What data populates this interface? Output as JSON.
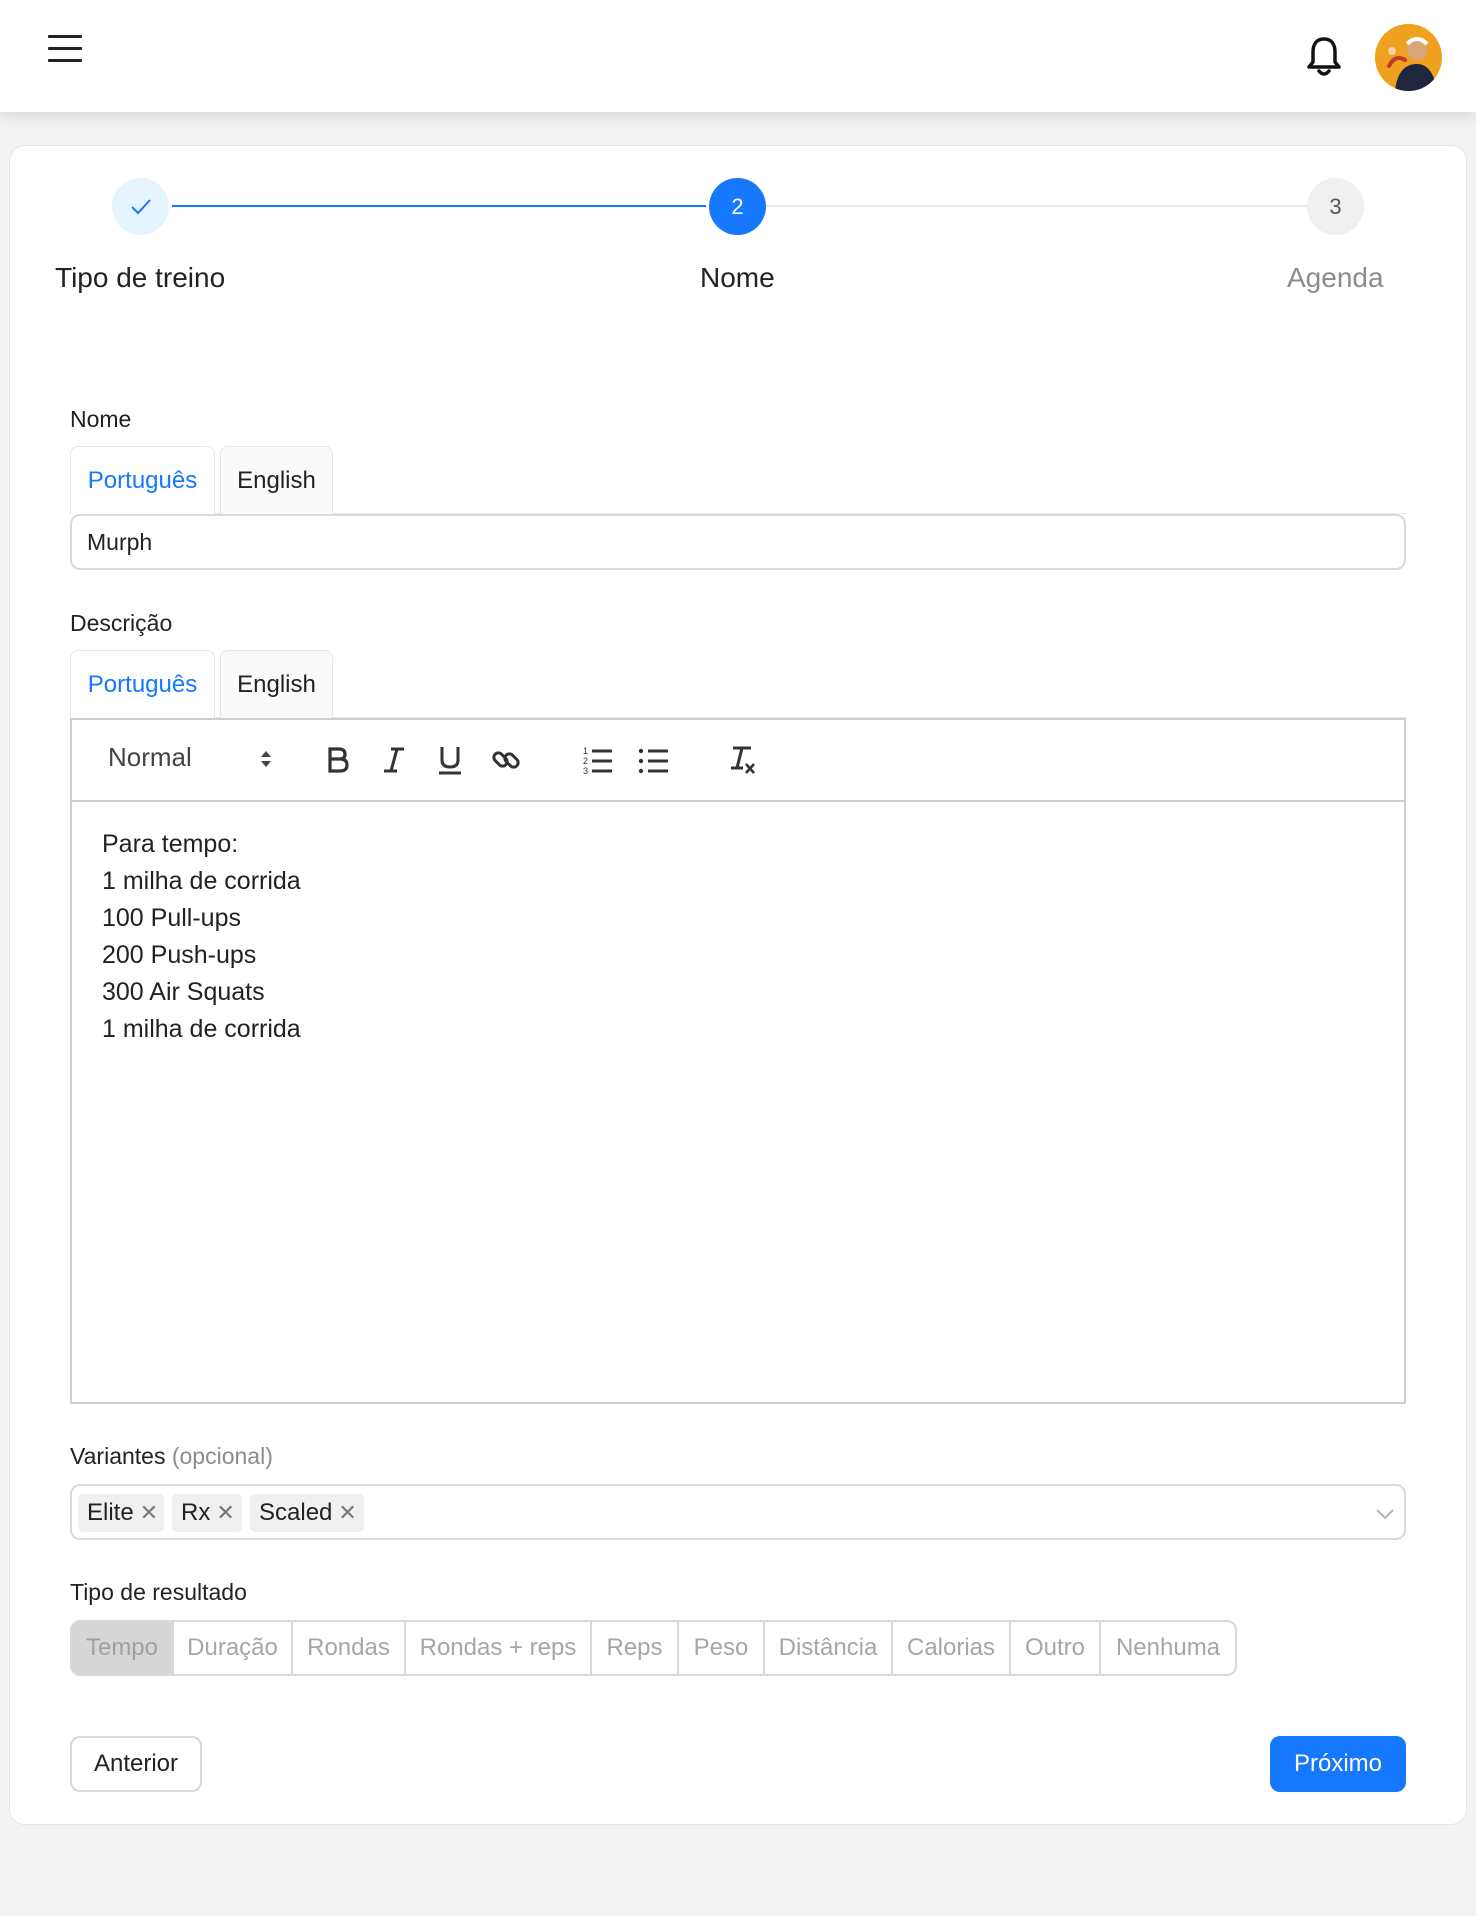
{
  "header": {
    "menu_icon": "hamburger-menu-icon",
    "notification_icon": "bell-icon",
    "avatar_icon": "user-avatar"
  },
  "steps": [
    {
      "number": "1",
      "label": "Tipo de treino",
      "status": "done"
    },
    {
      "number": "2",
      "label": "Nome",
      "status": "active"
    },
    {
      "number": "3",
      "label": "Agenda",
      "status": "pending"
    }
  ],
  "nome": {
    "label": "Nome",
    "tabs": [
      "Português",
      "English"
    ],
    "active_tab": "Português",
    "value": "Murph"
  },
  "descricao": {
    "label": "Descrição",
    "tabs": [
      "Português",
      "English"
    ],
    "active_tab": "Português",
    "toolbar": {
      "format_select": "Normal",
      "buttons": [
        "bold-icon",
        "italic-icon",
        "underline-icon",
        "link-icon",
        "ordered-list-icon",
        "bullet-list-icon",
        "clear-format-icon"
      ]
    },
    "lines": [
      "Para tempo:",
      "1 milha de corrida",
      "100 Pull-ups",
      "200 Push-ups",
      "300 Air Squats",
      "1 milha de corrida"
    ]
  },
  "variantes": {
    "label": "Variantes",
    "optional": "(opcional)",
    "tags": [
      "Elite",
      "Rx",
      "Scaled"
    ],
    "dropdown_icon": "chevron-down-icon"
  },
  "resultado": {
    "label": "Tipo de resultado",
    "options": [
      "Tempo",
      "Duração",
      "Rondas",
      "Rondas + reps",
      "Reps",
      "Peso",
      "Distância",
      "Calorias",
      "Outro",
      "Nenhuma"
    ],
    "selected": "Tempo"
  },
  "actions": {
    "previous": "Anterior",
    "next": "Próximo"
  },
  "colors": {
    "primary": "#1677ff",
    "done_step_bg": "#e6f4ff",
    "pending_step_bg": "#f0f0f0",
    "avatar_bg": "#f0a11f"
  }
}
